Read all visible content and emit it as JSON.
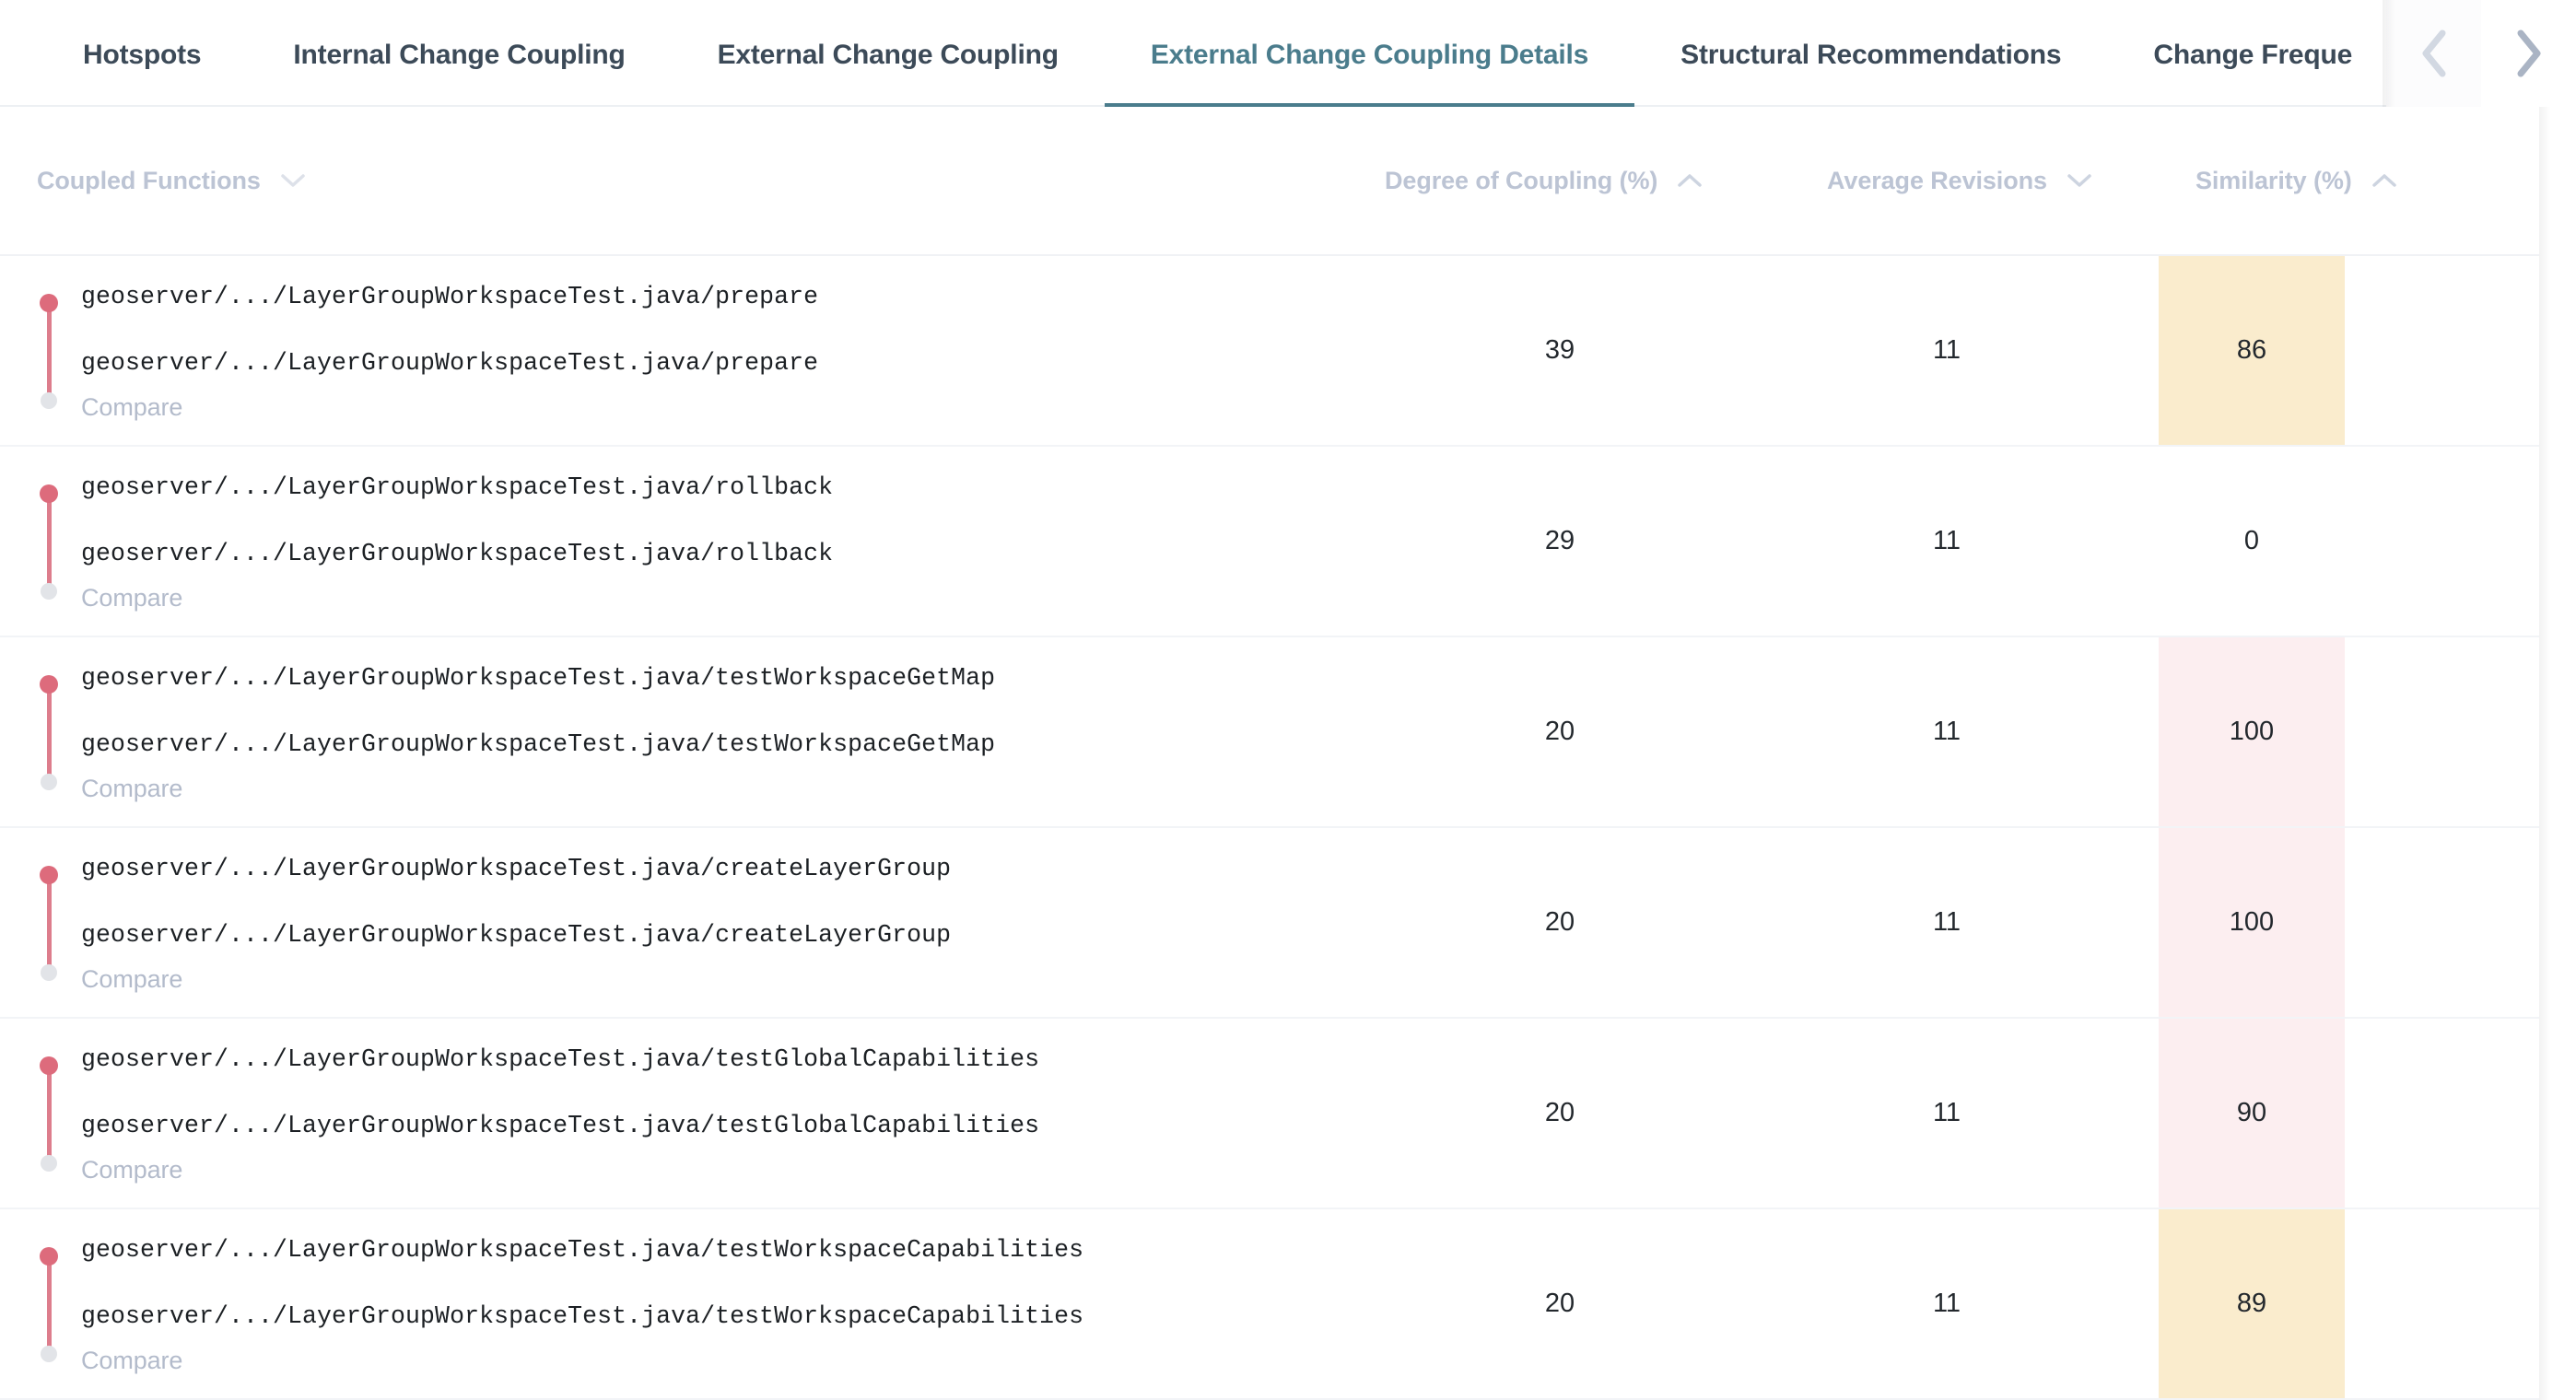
{
  "tabs": {
    "items": [
      {
        "label": "Hotspots",
        "active": false
      },
      {
        "label": "Internal Change Coupling",
        "active": false
      },
      {
        "label": "External Change Coupling",
        "active": false
      },
      {
        "label": "External Change Coupling Details",
        "active": true
      },
      {
        "label": "Structural Recommendations",
        "active": false
      },
      {
        "label": "Change Freque",
        "active": false
      }
    ],
    "prev_label": "chevron-left",
    "next_label": "chevron-right",
    "active_color": "#4a7c8c"
  },
  "table": {
    "columns": [
      {
        "label": "Coupled Functions",
        "sort": "down"
      },
      {
        "label": "Degree of Coupling (%)",
        "sort": "up"
      },
      {
        "label": "Average Revisions",
        "sort": "down"
      },
      {
        "label": "Similarity (%)",
        "sort": "up"
      }
    ],
    "compare_label": "Compare",
    "highlight_pink": "#fceef0",
    "highlight_cream": "#faeccd",
    "rows": [
      {
        "path_a": "geoserver/.../LayerGroupWorkspaceTest.java/prepare",
        "path_b": "geoserver/.../LayerGroupWorkspaceTest.java/prepare",
        "compare": "Compare",
        "degree": "39",
        "revisions": "11",
        "similarity": "86",
        "similarity_highlight": "cream"
      },
      {
        "path_a": "geoserver/.../LayerGroupWorkspaceTest.java/rollback",
        "path_b": "geoserver/.../LayerGroupWorkspaceTest.java/rollback",
        "compare": "Compare",
        "degree": "29",
        "revisions": "11",
        "similarity": "0",
        "similarity_highlight": "none"
      },
      {
        "path_a": "geoserver/.../LayerGroupWorkspaceTest.java/testWorkspaceGetMap",
        "path_b": "geoserver/.../LayerGroupWorkspaceTest.java/testWorkspaceGetMap",
        "compare": "Compare",
        "degree": "20",
        "revisions": "11",
        "similarity": "100",
        "similarity_highlight": "pink"
      },
      {
        "path_a": "geoserver/.../LayerGroupWorkspaceTest.java/createLayerGroup",
        "path_b": "geoserver/.../LayerGroupWorkspaceTest.java/createLayerGroup",
        "compare": "Compare",
        "degree": "20",
        "revisions": "11",
        "similarity": "100",
        "similarity_highlight": "pink"
      },
      {
        "path_a": "geoserver/.../LayerGroupWorkspaceTest.java/testGlobalCapabilities",
        "path_b": "geoserver/.../LayerGroupWorkspaceTest.java/testGlobalCapabilities",
        "compare": "Compare",
        "degree": "20",
        "revisions": "11",
        "similarity": "90",
        "similarity_highlight": "pink"
      },
      {
        "path_a": "geoserver/.../LayerGroupWorkspaceTest.java/testWorkspaceCapabilities",
        "path_b": "geoserver/.../LayerGroupWorkspaceTest.java/testWorkspaceCapabilities",
        "compare": "Compare",
        "degree": "20",
        "revisions": "11",
        "similarity": "89",
        "similarity_highlight": "cream"
      }
    ]
  }
}
